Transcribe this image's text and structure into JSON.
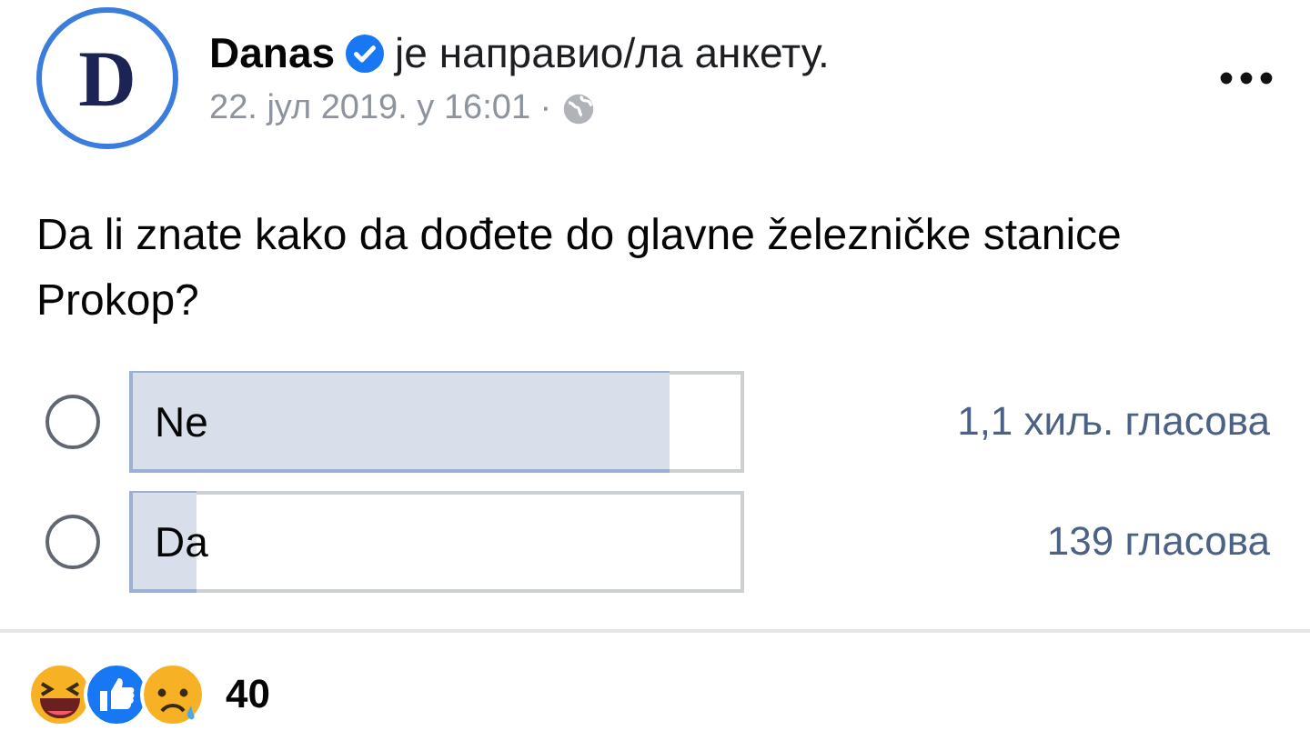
{
  "post": {
    "avatar_letter": "D",
    "author": "Danas",
    "verified": true,
    "action": "је направио/ла анкету.",
    "date": "22. јул 2019. у 16:01 ·"
  },
  "question": "Da li znate kako da dođete do glavne železničke stanice Prokop?",
  "options": [
    {
      "label": "Ne",
      "selected": false,
      "level": 0.89,
      "votes": "1,1 хиљ. гласова"
    },
    {
      "label": "Da",
      "selected": false,
      "level": 0.11,
      "votes": "139 гласова"
    }
  ],
  "reactions": {
    "count": "40"
  }
}
